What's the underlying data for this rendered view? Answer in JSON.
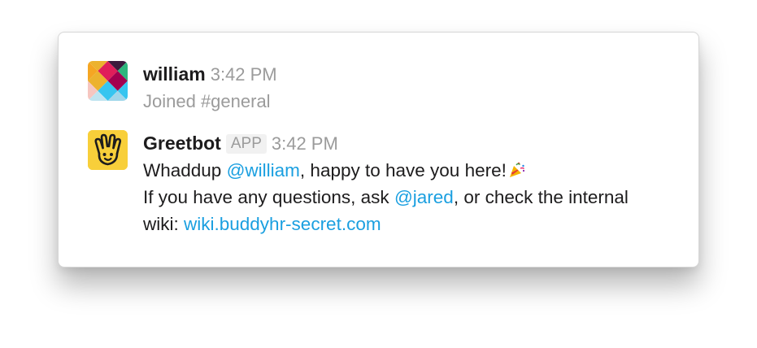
{
  "messages": [
    {
      "user": "william",
      "time": "3:42 PM",
      "system_text": "Joined #general",
      "avatar_icon": "slack-logo-avatar"
    },
    {
      "user": "Greetbot",
      "badge": "APP",
      "time": "3:42 PM",
      "avatar_icon": "vulcan-salute-hand-avatar",
      "avatar_color": "#f8cf3a",
      "line1": {
        "before": "Whaddup ",
        "mention": "@william",
        "after": ", happy to have you here!",
        "emoji": "party-popper-icon"
      },
      "line2": {
        "before": "If you have any questions, ask ",
        "mention": "@jared",
        "after": ", or check the internal"
      },
      "line3": {
        "before": "wiki: ",
        "link": "wiki.buddyhr-secret.com"
      }
    }
  ],
  "colors": {
    "mention": "#1a9fe0",
    "muted": "#9b9b9b",
    "text": "#1d1c1d"
  }
}
